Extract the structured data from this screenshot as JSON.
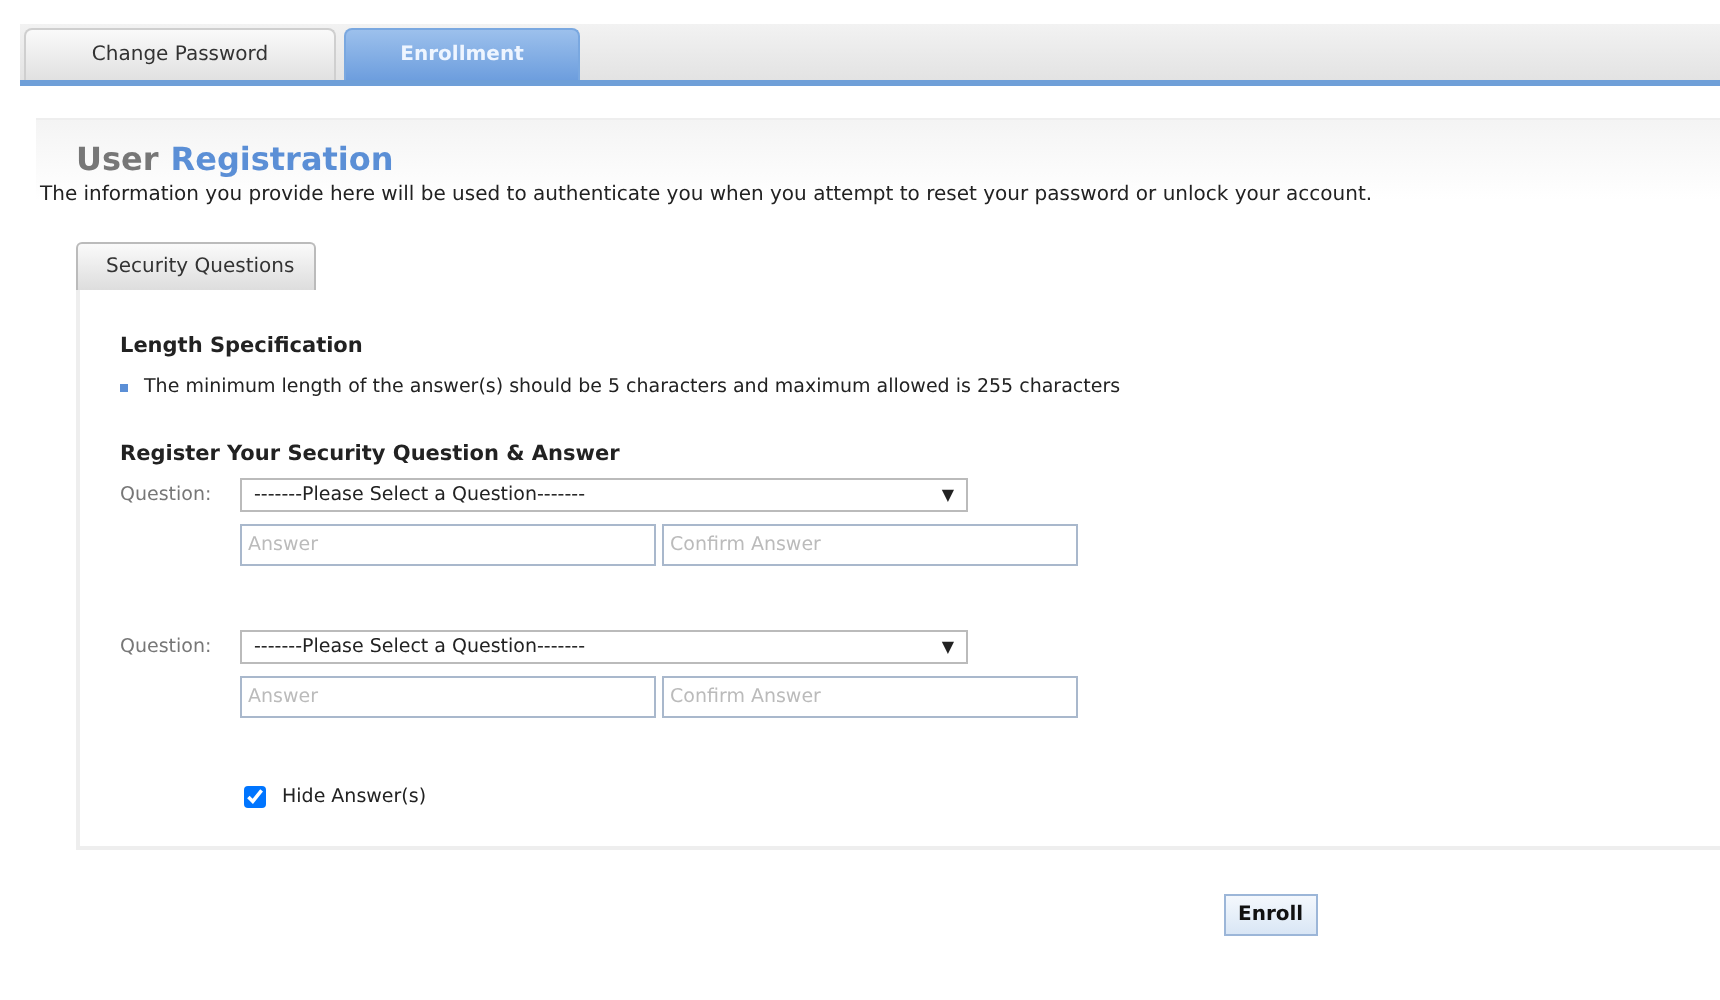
{
  "tabs": [
    {
      "label": "Change Password",
      "selected": false
    },
    {
      "label": "Enrollment",
      "selected": true
    }
  ],
  "title": {
    "first": "User",
    "second": "Registration"
  },
  "intro": "The information you provide here will be used to authenticate you when you attempt to reset your password or unlock your account.",
  "section_tabs": [
    {
      "label": "Security Questions",
      "selected": true
    }
  ],
  "length_spec": {
    "heading": "Length Specification",
    "items": [
      "The minimum length of the answer(s) should be 5 characters and maximum allowed is 255 characters"
    ]
  },
  "register_heading": "Register Your Security Question & Answer",
  "questions": [
    {
      "label": "Question:",
      "select": "-------Please Select a Question-------",
      "caret": "▼",
      "answer_placeholder": "Answer",
      "confirm_placeholder": "Confirm Answer"
    },
    {
      "label": "Question:",
      "select": "-------Please Select a Question-------",
      "caret": "▼",
      "answer_placeholder": "Answer",
      "confirm_placeholder": "Confirm Answer"
    }
  ],
  "hide_answers": {
    "label": "Hide Answer(s)",
    "checked": true
  },
  "enroll_button": "Enroll"
}
